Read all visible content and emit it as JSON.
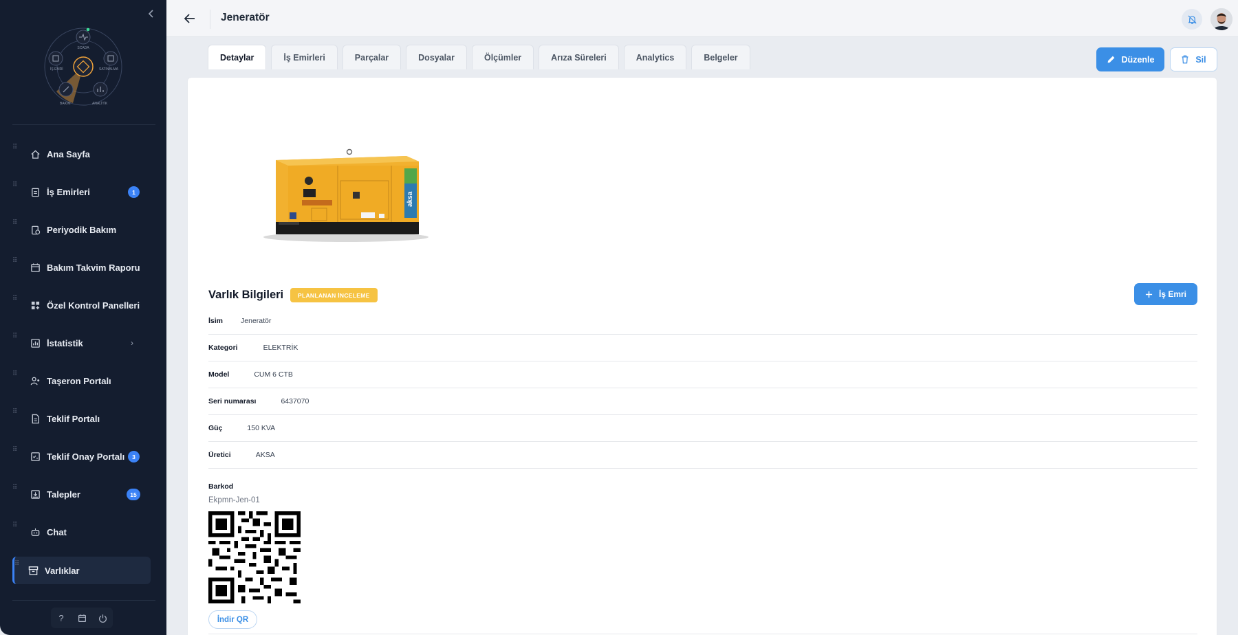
{
  "sidebar": {
    "logo_labels": {
      "top": "SCADA",
      "left": "İŞ EMRİ",
      "right": "SATINALMA",
      "bottom_left": "BAKIM",
      "bottom_right": "ANALİTİK"
    },
    "items": [
      {
        "label": "Ana Sayfa",
        "icon": "home-icon"
      },
      {
        "label": "İş Emirleri",
        "icon": "clipboard-icon",
        "badge": "1"
      },
      {
        "label": "Periyodik Bakım",
        "icon": "clipboard-clock-icon"
      },
      {
        "label": "Bakım Takvim Raporu",
        "icon": "calendar-icon"
      },
      {
        "label": "Özel Kontrol Panelleri",
        "icon": "dashboard-icon"
      },
      {
        "label": "İstatistik",
        "icon": "chart-icon",
        "expandable": true
      },
      {
        "label": "Taşeron Portalı",
        "icon": "contractor-icon"
      },
      {
        "label": "Teklif Portalı",
        "icon": "document-icon"
      },
      {
        "label": "Teklif Onay Portalı",
        "icon": "checklist-icon",
        "badge": "3"
      },
      {
        "label": "Talepler",
        "icon": "inbox-icon",
        "badge": "15"
      },
      {
        "label": "Chat",
        "icon": "robot-icon"
      },
      {
        "label": "Varlıklar",
        "icon": "archive-icon",
        "active": true
      }
    ],
    "footer": [
      "help-icon",
      "calendar-icon",
      "power-icon"
    ]
  },
  "header": {
    "title": "Jeneratör"
  },
  "tabs": [
    "Detaylar",
    "İş Emirleri",
    "Parçalar",
    "Dosyalar",
    "Ölçümler",
    "Arıza Süreleri",
    "Analytics",
    "Belgeler"
  ],
  "active_tab": "Detaylar",
  "actions": {
    "edit_label": "Düzenle",
    "delete_label": "Sil"
  },
  "asset": {
    "section_title": "Varlık Bilgileri",
    "status": "PLANLANAN İNCELEME",
    "work_order_label": "İş Emri",
    "image_brand": "aksa",
    "fields": [
      {
        "label": "İsim",
        "value": "Jeneratör"
      },
      {
        "label": "Kategori",
        "value": "ELEKTRİK"
      },
      {
        "label": "Model",
        "value": "CUM 6 CTB"
      },
      {
        "label": "Seri numarası",
        "value": "6437070"
      },
      {
        "label": "Güç",
        "value": "150 KVA"
      },
      {
        "label": "Üretici",
        "value": "AKSA"
      }
    ],
    "barcode_label": "Barkod",
    "barcode_value": "Ekpmn-Jen-01",
    "download_qr_label": "İndir QR"
  },
  "colors": {
    "sidebar_bg": "#141d2f",
    "accent": "#3b8fe6",
    "status_badge": "#f6c343",
    "generator_body": "#f2b12f"
  }
}
